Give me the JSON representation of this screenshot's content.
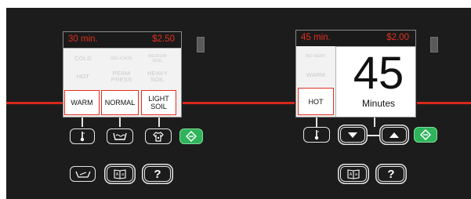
{
  "left_panel": {
    "time": "30 min.",
    "price": "$2.50",
    "temp_options": [
      "COLD",
      "HOT"
    ],
    "temp_selected": "WARM",
    "cycle_options": [
      "DELICATE",
      "PERM PRESS"
    ],
    "cycle_selected": "NORMAL",
    "soil_options": [
      "MEDIUM SOIL",
      "HEAVY SOIL"
    ],
    "soil_selected": "LIGHT SOIL"
  },
  "right_panel": {
    "time": "45 min.",
    "price": "$2.00",
    "temp_options": [
      "NO HEAT",
      "WARM"
    ],
    "temp_selected": "HOT",
    "minutes_value": "45",
    "minutes_label": "Minutes"
  },
  "buttons": {
    "help_label": "?",
    "help_label_right": "?"
  },
  "icons": {
    "temperature": "thermometer-icon",
    "cycle": "wash-tub-icon",
    "soil": "shirt-icon",
    "start": "start-diamond-icon",
    "extra_rinse": "rinse-icon",
    "language": "language-book-icon",
    "down": "down-arrow-icon",
    "up": "up-arrow-icon"
  },
  "colors": {
    "accent_red": "#e0301e",
    "start_green": "#2fb35b",
    "panel_bg": "#1c1c1c"
  }
}
